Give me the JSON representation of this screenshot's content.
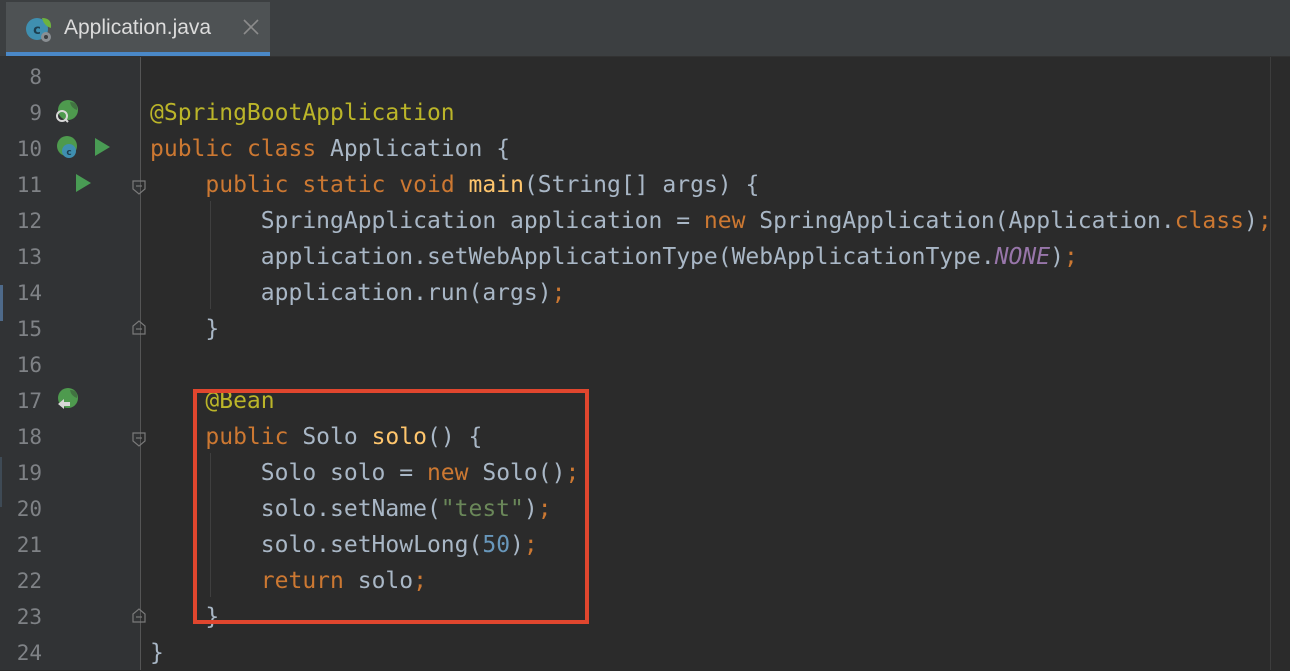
{
  "tab": {
    "file_name": "Application.java",
    "icon": "spring-boot-class-icon",
    "close_icon": "close-icon"
  },
  "colors": {
    "keyword": "#cc7832",
    "annotation": "#bbb529",
    "method": "#ffc66d",
    "string": "#6a8759",
    "number": "#6897bb",
    "constant": "#9876aa",
    "text": "#a9b7c6",
    "highlight_box": "#e0462e"
  },
  "lines": [
    {
      "n": "8"
    },
    {
      "n": "9",
      "t": [
        "@SpringBootApplication"
      ]
    },
    {
      "n": "10",
      "t": [
        "public",
        " ",
        "class",
        " Application {"
      ]
    },
    {
      "n": "11",
      "t": [
        "    ",
        "public",
        " ",
        "static",
        " ",
        "void",
        " ",
        "main",
        "(String[] args) {"
      ]
    },
    {
      "n": "12",
      "t": [
        "        SpringApplication application = ",
        "new",
        " SpringApplication(Application.",
        "class",
        ")",
        ";"
      ]
    },
    {
      "n": "13",
      "t": [
        "        application.setWebApplicationType(WebApplicationType.",
        "NONE",
        ")",
        ";"
      ]
    },
    {
      "n": "14",
      "t": [
        "        application.run(args)",
        ";"
      ]
    },
    {
      "n": "15",
      "t": [
        "    }"
      ]
    },
    {
      "n": "16"
    },
    {
      "n": "17",
      "t": [
        "    ",
        "@Bean"
      ]
    },
    {
      "n": "18",
      "t": [
        "    ",
        "public",
        " Solo ",
        "solo",
        "() {"
      ]
    },
    {
      "n": "19",
      "t": [
        "        Solo solo = ",
        "new",
        " Solo()",
        ";"
      ]
    },
    {
      "n": "20",
      "t": [
        "        solo.setName(",
        "\"test\"",
        ")",
        ";"
      ]
    },
    {
      "n": "21",
      "t": [
        "        solo.setHowLong(",
        "50",
        ")",
        ";"
      ]
    },
    {
      "n": "22",
      "t": [
        "        ",
        "return",
        " solo",
        ";"
      ]
    },
    {
      "n": "23",
      "t": [
        "    }"
      ]
    },
    {
      "n": "24",
      "t": [
        "}"
      ]
    }
  ]
}
